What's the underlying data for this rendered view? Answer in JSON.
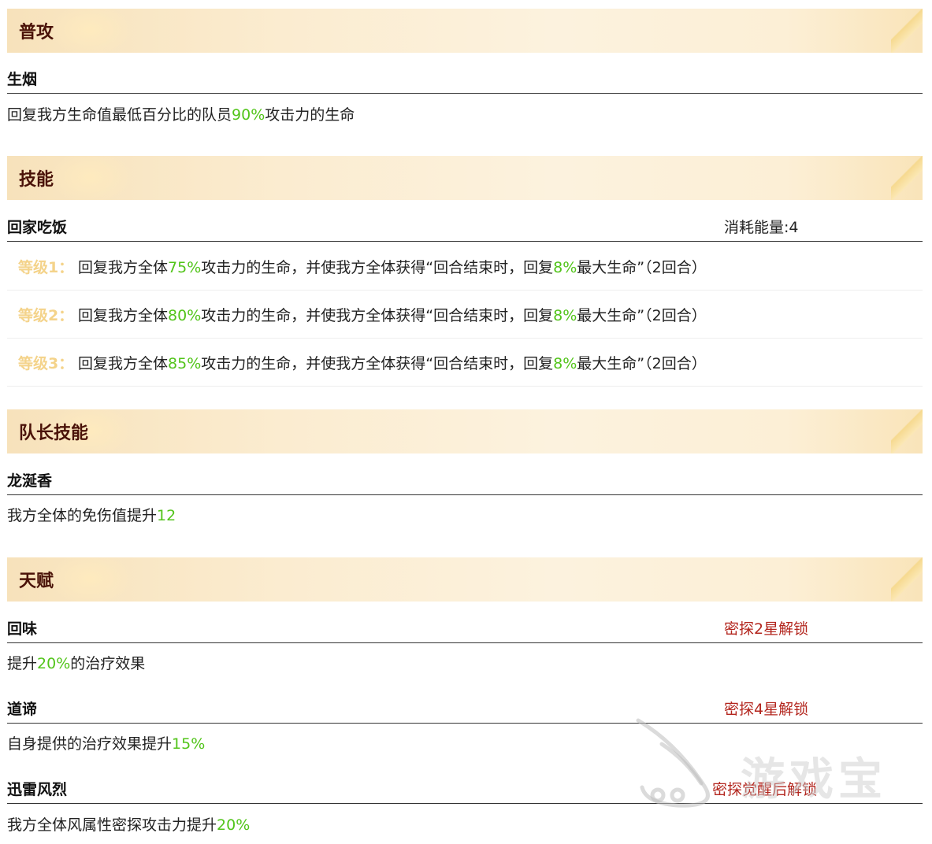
{
  "sections": {
    "attack": {
      "title": "普攻",
      "skill_name": "生烟",
      "desc": {
        "pre": "回复我方生命值最低百分比的队员",
        "hl": "90%",
        "post": "攻击力的生命"
      }
    },
    "skill": {
      "title": "技能",
      "skill_name": "回家吃饭",
      "cost": "消耗能量:4",
      "levels": [
        {
          "label": "等级1：",
          "pre": "回复我方全体",
          "hl": "75%",
          "mid": "攻击力的生命，并使我方全体获得“回合结束时，回复",
          "hl2": "8%",
          "post": "最大生命”（2回合）"
        },
        {
          "label": "等级2：",
          "pre": "回复我方全体",
          "hl": "80%",
          "mid": "攻击力的生命，并使我方全体获得“回合结束时，回复",
          "hl2": "8%",
          "post": "最大生命”（2回合）"
        },
        {
          "label": "等级3：",
          "pre": "回复我方全体",
          "hl": "85%",
          "mid": "攻击力的生命，并使我方全体获得“回合结束时，回复",
          "hl2": "8%",
          "post": "最大生命”（2回合）"
        }
      ]
    },
    "leader": {
      "title": "队长技能",
      "skill_name": "龙涎香",
      "desc": {
        "pre": "我方全体的免伤值提升",
        "hl": "12",
        "post": ""
      }
    },
    "talent": {
      "title": "天赋",
      "items": [
        {
          "name": "回味",
          "unlock": "密探2星解锁",
          "pre": "提升",
          "hl": "20%",
          "post": "的治疗效果"
        },
        {
          "name": "道谛",
          "unlock": "密探4星解锁",
          "pre": "自身提供的治疗效果提升",
          "hl": "15%",
          "post": ""
        },
        {
          "name": "迅雷风烈",
          "unlock": "密探觉醒后解锁",
          "pre": "我方全体风属性密探攻击力提升",
          "hl": "20%",
          "post": ""
        }
      ]
    }
  },
  "watermark": {
    "text": "游戏宝",
    "icon": "mascot-logo-icon"
  },
  "colors": {
    "highlight": "#52c41a",
    "unlock": "#b3261e",
    "level": "#f4d38a",
    "title": "#4a1208"
  }
}
